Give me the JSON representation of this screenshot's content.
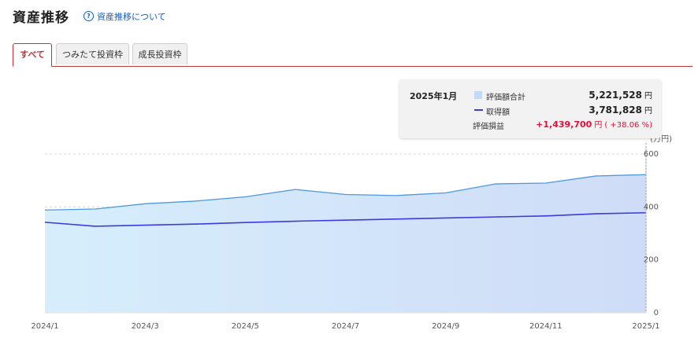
{
  "header": {
    "title": "資産推移",
    "help_icon": "question-circle-icon",
    "help_label": "資産推移について"
  },
  "tabs": [
    {
      "label": "すべて",
      "active": true
    },
    {
      "label": "つみたて投資枠",
      "active": false
    },
    {
      "label": "成長投資枠",
      "active": false
    }
  ],
  "tooltip": {
    "date": "2025年1月",
    "valuation_label": "評価額合計",
    "valuation_value": "5,221,528",
    "cost_label": "取得額",
    "cost_value": "3,781,828",
    "gain_label": "評価損益",
    "gain_value": "+1,439,700",
    "gain_pct": "( +38.06 %)",
    "unit": "円"
  },
  "colors": {
    "accent": "#b8383b",
    "area_line": "#4c97e6",
    "cost_line": "#3d3ae0",
    "gain": "#e0103a"
  },
  "chart_data": {
    "type": "area",
    "ylabel": "(万円)",
    "ylim": [
      0,
      600
    ],
    "yticks": [
      "0",
      "200",
      "400",
      "600"
    ],
    "x": [
      "2024/1",
      "2024/2",
      "2024/3",
      "2024/4",
      "2024/5",
      "2024/6",
      "2024/7",
      "2024/8",
      "2024/9",
      "2024/10",
      "2024/11",
      "2024/12",
      "2025/1"
    ],
    "xtick_labels": [
      "2024/1",
      "",
      "2024/3",
      "",
      "2024/5",
      "",
      "2024/7",
      "",
      "2024/9",
      "",
      "2024/11",
      "",
      "2025/1"
    ],
    "grid": true,
    "series": [
      {
        "name": "評価額合計",
        "type": "area",
        "values": [
          388,
          392,
          412,
          422,
          438,
          466,
          447,
          443,
          453,
          487,
          490,
          517,
          522
        ]
      },
      {
        "name": "取得額",
        "type": "line",
        "values": [
          342,
          327,
          331,
          335,
          341,
          346,
          350,
          354,
          358,
          362,
          366,
          374,
          378
        ]
      }
    ]
  }
}
